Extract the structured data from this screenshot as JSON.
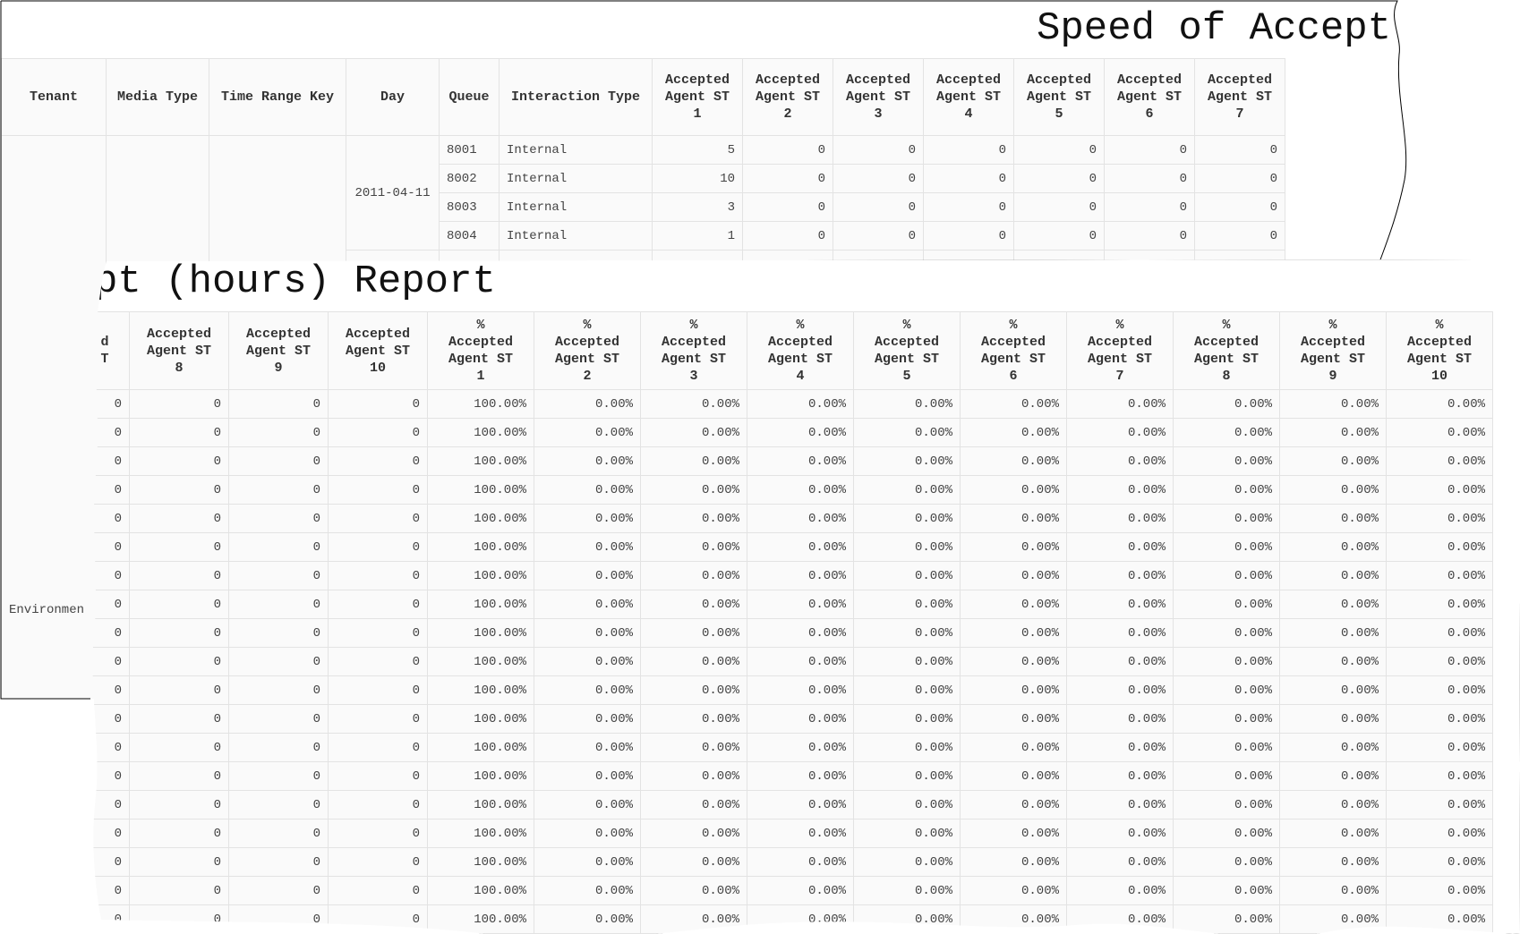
{
  "back_report": {
    "title": "Speed of Accept",
    "headers": [
      [
        "Tenant"
      ],
      [
        "Media Type"
      ],
      [
        "Time Range Key"
      ],
      [
        "Day"
      ],
      [
        "Queue"
      ],
      [
        "Interaction Type"
      ],
      [
        "Accepted",
        "Agent ST",
        "1"
      ],
      [
        "Accepted",
        "Agent ST",
        "2"
      ],
      [
        "Accepted",
        "Agent ST",
        "3"
      ],
      [
        "Accepted",
        "Agent ST",
        "4"
      ],
      [
        "Accepted",
        "Agent ST",
        "5"
      ],
      [
        "Accepted",
        "Agent ST",
        "6"
      ],
      [
        "Accepted",
        "Agent ST",
        "7"
      ]
    ],
    "day": "2011-04-11",
    "tenant": "Environmen",
    "rows": [
      {
        "queue": "8001",
        "type": "Internal",
        "values": [
          "5",
          "0",
          "0",
          "0",
          "0",
          "0",
          "0"
        ]
      },
      {
        "queue": "8002",
        "type": "Internal",
        "values": [
          "10",
          "0",
          "0",
          "0",
          "0",
          "0",
          "0"
        ]
      },
      {
        "queue": "8003",
        "type": "Internal",
        "values": [
          "3",
          "0",
          "0",
          "0",
          "0",
          "0",
          "0"
        ]
      },
      {
        "queue": "8004",
        "type": "Internal",
        "values": [
          "1",
          "0",
          "0",
          "0",
          "0",
          "0",
          "0"
        ]
      }
    ]
  },
  "front_report": {
    "title": "pt (hours) Report",
    "headers": [
      [
        "d",
        "T",
        ""
      ],
      [
        "Accepted",
        "Agent ST",
        "8"
      ],
      [
        "Accepted",
        "Agent ST",
        "9"
      ],
      [
        "Accepted",
        "Agent ST",
        "10"
      ],
      [
        "%",
        "Accepted",
        "Agent ST",
        "1"
      ],
      [
        "%",
        "Accepted",
        "Agent ST",
        "2"
      ],
      [
        "%",
        "Accepted",
        "Agent ST",
        "3"
      ],
      [
        "%",
        "Accepted",
        "Agent ST",
        "4"
      ],
      [
        "%",
        "Accepted",
        "Agent ST",
        "5"
      ],
      [
        "%",
        "Accepted",
        "Agent ST",
        "6"
      ],
      [
        "%",
        "Accepted",
        "Agent ST",
        "7"
      ],
      [
        "%",
        "Accepted",
        "Agent ST",
        "8"
      ],
      [
        "%",
        "Accepted",
        "Agent ST",
        "9"
      ],
      [
        "%",
        "Accepted",
        "Agent ST",
        "10"
      ]
    ],
    "row_values": [
      "0",
      "0",
      "0",
      "0",
      "100.00%",
      "0.00%",
      "0.00%",
      "0.00%",
      "0.00%",
      "0.00%",
      "0.00%",
      "0.00%",
      "0.00%",
      "0.00%"
    ],
    "row_count": 19
  }
}
